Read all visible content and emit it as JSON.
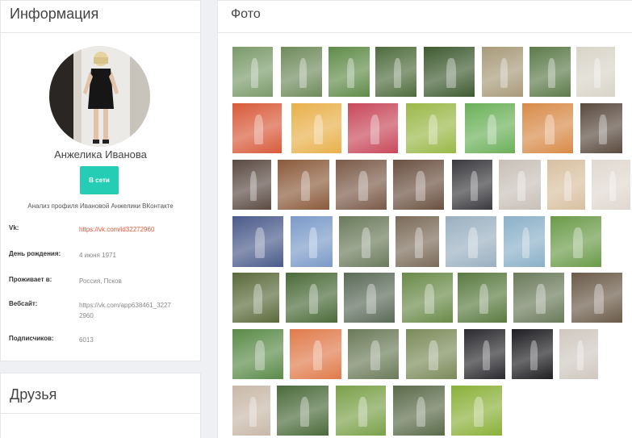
{
  "info": {
    "title": "Информация",
    "name": "Анжелика Иванова",
    "online_button": "В сети",
    "caption": "Анализ профиля Ивановой Анжелики ВКонтакте",
    "rows": [
      {
        "label": "Vk:",
        "value": "https://vk.com/id32272960",
        "link": true
      },
      {
        "label": "День рождения:",
        "value": "4 июня 1971",
        "link": false
      },
      {
        "label": "Проживает в:",
        "value": "Россия, Псков",
        "link": false
      },
      {
        "label": "Вебсайт:",
        "value": "https://vk.com/app638461_32272960",
        "link": false
      },
      {
        "label": "Подписчиков:",
        "value": "6013",
        "link": false
      }
    ]
  },
  "friends": {
    "title": "Друзья"
  },
  "photos": {
    "title": "Фото",
    "rows": [
      [
        "#7a9a6a",
        "#6f8a5c",
        "#5f8b48",
        "#4e6b3c",
        "#3e5a30",
        "#a89a7a",
        "#5c7a4a",
        "#d8d4c8"
      ],
      [
        "#d85a3a",
        "#e8b04a",
        "#c8485a",
        "#9ab848",
        "#6ab058",
        "#d88a48",
        "#5a4a3e"
      ],
      [
        "#5a4a42",
        "#8a5a3a",
        "#7a5a48",
        "#6a5040",
        "#3a3a3e",
        "#c8c0b8",
        "#d8c0a0",
        "#e0d8d0"
      ],
      [
        "#4a5a8a",
        "#7a9ac8",
        "#6a7a5a",
        "#7a6a58",
        "#9ab0c0",
        "#8ab0c8",
        "#6a9a48"
      ],
      [
        "#5a6a3a",
        "#4a6a38",
        "#5a6a58",
        "#6a8a48",
        "#5a7a40",
        "#6a7a5a",
        "#6a5a48"
      ],
      [
        "#5a8a48",
        "#e07a4a",
        "#6a7a58",
        "#7a8a58",
        "#2a2a2e",
        "#1e1e22",
        "#d0c8c0"
      ],
      [
        "#c8b8a8",
        "#4a6a3a",
        "#7aa048",
        "#5a6a48",
        "#8ab038"
      ]
    ]
  }
}
